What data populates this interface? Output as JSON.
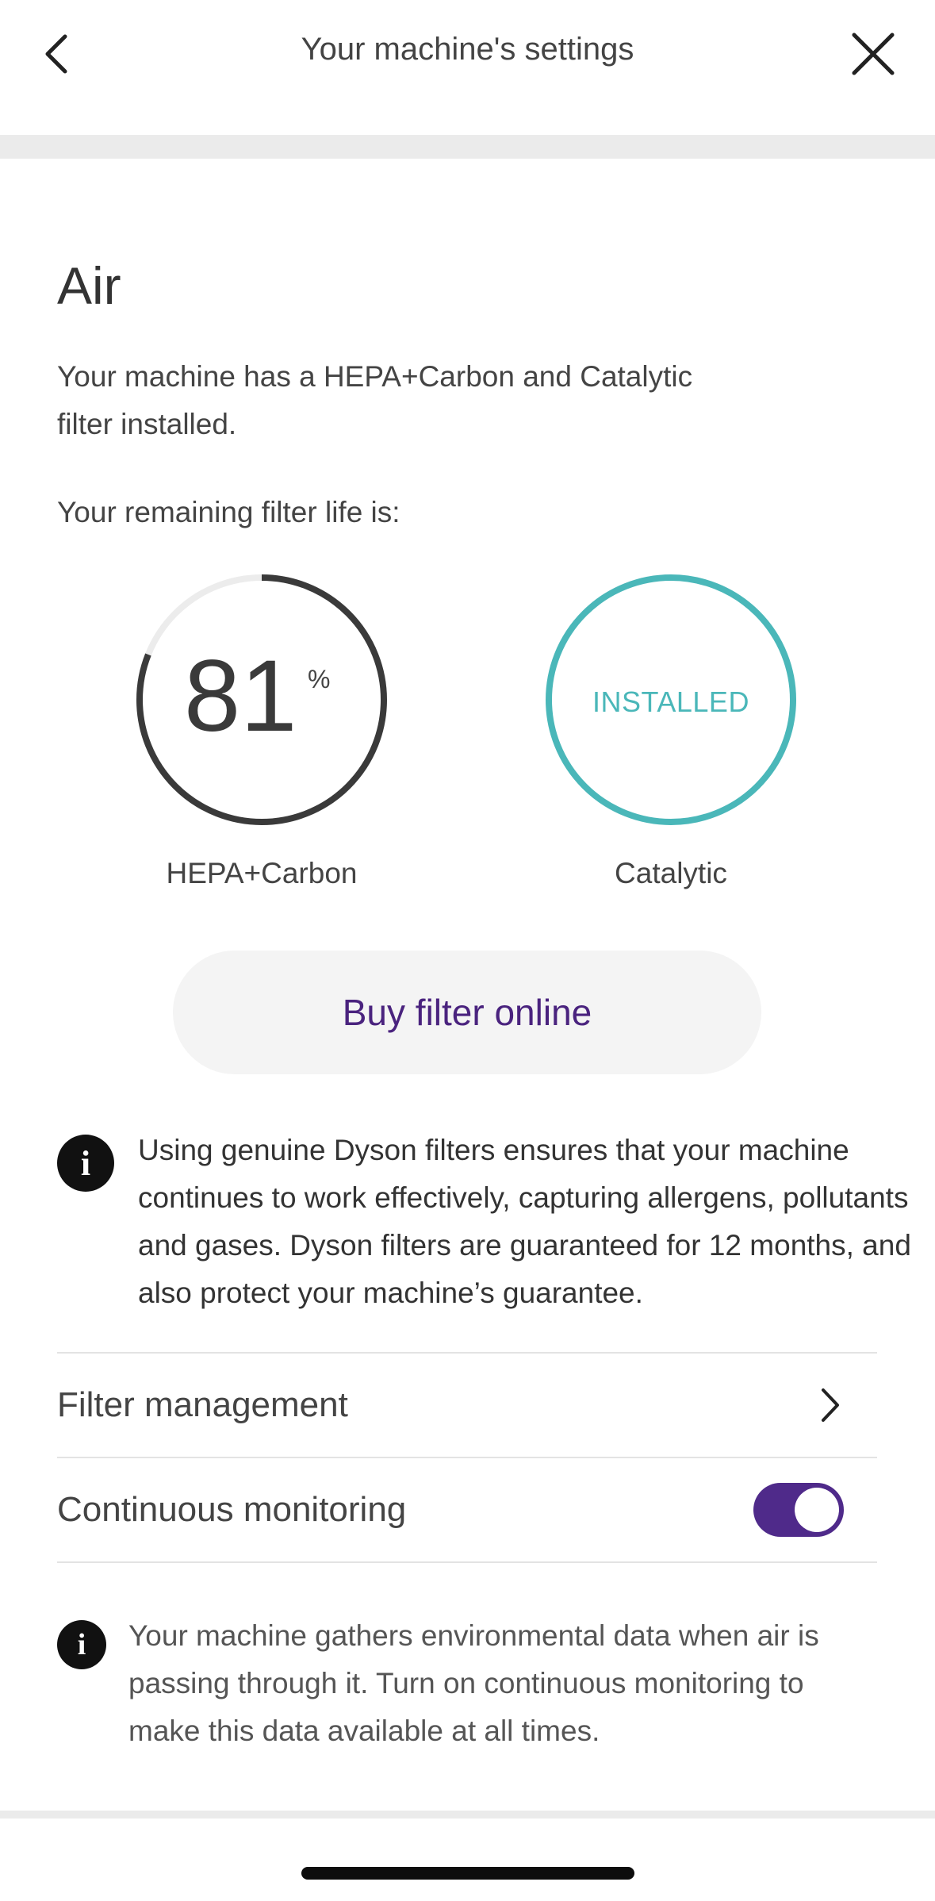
{
  "header": {
    "title": "Your machine's settings",
    "back_icon": "chevron-left-icon",
    "close_icon": "close-icon"
  },
  "section": {
    "title": "Air",
    "intro": "Your machine has a HEPA+Carbon and Catalytic filter installed.",
    "filter_life_label": "Your remaining filter life is:"
  },
  "filters": [
    {
      "name": "HEPA+Carbon",
      "value": "81",
      "unit": "%",
      "remaining_fraction": 0.81,
      "color": "#3a3a3a",
      "track_color": "#ececec"
    },
    {
      "name": "Catalytic",
      "status": "INSTALLED",
      "color": "#4ab7b9"
    }
  ],
  "buy_button": {
    "label": "Buy filter online",
    "color": "#4a237e"
  },
  "info_genuine": {
    "icon": "info-icon",
    "glyph": "i",
    "text": "Using genuine Dyson filters ensures that your machine continues to work effectively, capturing allergens, pollutants and gases. Dyson filters are guaranteed for 12 months, and also protect your machine’s guarantee."
  },
  "rows": {
    "filter_management": {
      "label": "Filter management",
      "icon": "chevron-right-icon"
    },
    "continuous_monitoring": {
      "label": "Continuous monitoring",
      "enabled": true,
      "toggle_color": "#4f2a8a"
    }
  },
  "info_monitoring": {
    "icon": "info-icon",
    "glyph": "i",
    "text": "Your machine gathers environmental data when air is passing through it. Turn on continuous monitoring to make this data available at all times."
  }
}
